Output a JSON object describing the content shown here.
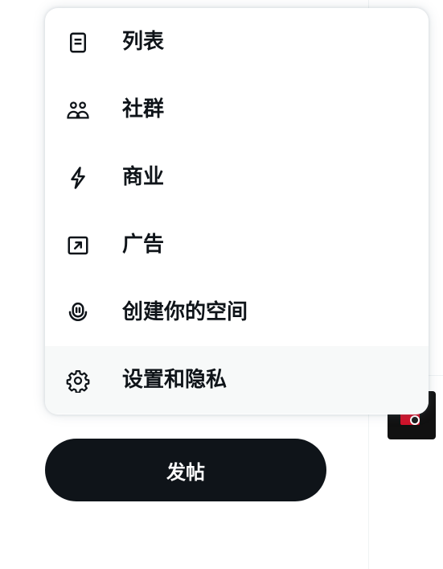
{
  "menu": {
    "items": [
      {
        "label": "列表",
        "icon": "list-icon"
      },
      {
        "label": "社群",
        "icon": "communities-icon"
      },
      {
        "label": "商业",
        "icon": "lightning-icon"
      },
      {
        "label": "广告",
        "icon": "ads-arrow-icon"
      },
      {
        "label": "创建你的空间",
        "icon": "spaces-mic-icon"
      },
      {
        "label": "设置和隐私",
        "icon": "gear-icon",
        "hovered": true
      }
    ]
  },
  "post_button": {
    "label": "发帖"
  },
  "colors": {
    "text": "#0f1419",
    "hover_bg": "#f7f9f9",
    "button_bg": "#0f1419",
    "thumbnail_accent": "#d0122a"
  }
}
